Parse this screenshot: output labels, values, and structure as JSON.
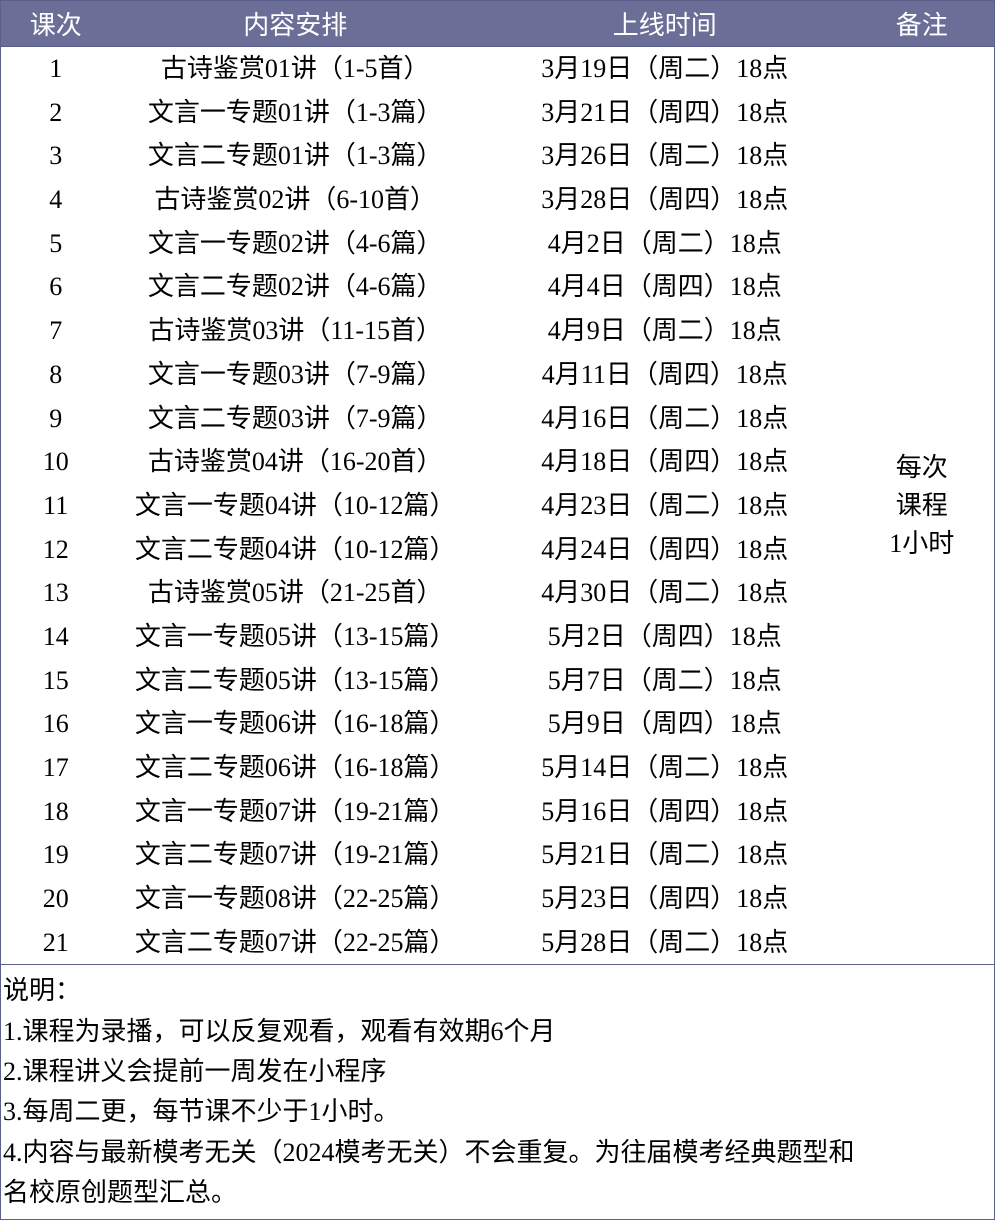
{
  "headers": {
    "num": "课次",
    "content": "内容安排",
    "time": "上线时间",
    "note": "备注"
  },
  "rows": [
    {
      "num": "1",
      "content": "古诗鉴赏01讲（1-5首）",
      "time": "3月19日（周二）18点"
    },
    {
      "num": "2",
      "content": "文言一专题01讲（1-3篇）",
      "time": "3月21日（周四）18点"
    },
    {
      "num": "3",
      "content": "文言二专题01讲（1-3篇）",
      "time": "3月26日（周二）18点"
    },
    {
      "num": "4",
      "content": "古诗鉴赏02讲（6-10首）",
      "time": "3月28日（周四）18点"
    },
    {
      "num": "5",
      "content": "文言一专题02讲（4-6篇）",
      "time": "4月2日（周二）18点"
    },
    {
      "num": "6",
      "content": "文言二专题02讲（4-6篇）",
      "time": "4月4日（周四）18点"
    },
    {
      "num": "7",
      "content": "古诗鉴赏03讲（11-15首）",
      "time": "4月9日（周二）18点"
    },
    {
      "num": "8",
      "content": "文言一专题03讲（7-9篇）",
      "time": "4月11日（周四）18点"
    },
    {
      "num": "9",
      "content": "文言二专题03讲（7-9篇）",
      "time": "4月16日（周二）18点"
    },
    {
      "num": "10",
      "content": "古诗鉴赏04讲（16-20首）",
      "time": "4月18日（周四）18点"
    },
    {
      "num": "11",
      "content": "文言一专题04讲（10-12篇）",
      "time": "4月23日（周二）18点"
    },
    {
      "num": "12",
      "content": "文言二专题04讲（10-12篇）",
      "time": "4月24日（周四）18点"
    },
    {
      "num": "13",
      "content": "古诗鉴赏05讲（21-25首）",
      "time": "4月30日（周二）18点"
    },
    {
      "num": "14",
      "content": "文言一专题05讲（13-15篇）",
      "time": "5月2日（周四）18点"
    },
    {
      "num": "15",
      "content": "文言二专题05讲（13-15篇）",
      "time": "5月7日（周二）18点"
    },
    {
      "num": "16",
      "content": "文言一专题06讲（16-18篇）",
      "time": "5月9日（周四）18点"
    },
    {
      "num": "17",
      "content": "文言二专题06讲（16-18篇）",
      "time": "5月14日（周二）18点"
    },
    {
      "num": "18",
      "content": "文言一专题07讲（19-21篇）",
      "time": "5月16日（周四）18点"
    },
    {
      "num": "19",
      "content": "文言二专题07讲（19-21篇）",
      "time": "5月21日（周二）18点"
    },
    {
      "num": "20",
      "content": "文言一专题08讲（22-25篇）",
      "time": "5月23日（周四）18点"
    },
    {
      "num": "21",
      "content": "文言二专题07讲（22-25篇）",
      "time": "5月28日（周二）18点"
    }
  ],
  "note_merged": {
    "line1": "每次",
    "line2": "课程",
    "line3": "1小时"
  },
  "notes": {
    "title": "说明：",
    "item1": "1.课程为录播，可以反复观看，观看有效期6个月",
    "item2": "2.课程讲义会提前一周发在小程序",
    "item3": "3.每周二更，每节课不少于1小时。",
    "item4a": "4.内容与最新模考无关（2024模考无关）不会重复。为往届模考经典题型和",
    "item4b": "名校原创题型汇总。"
  }
}
